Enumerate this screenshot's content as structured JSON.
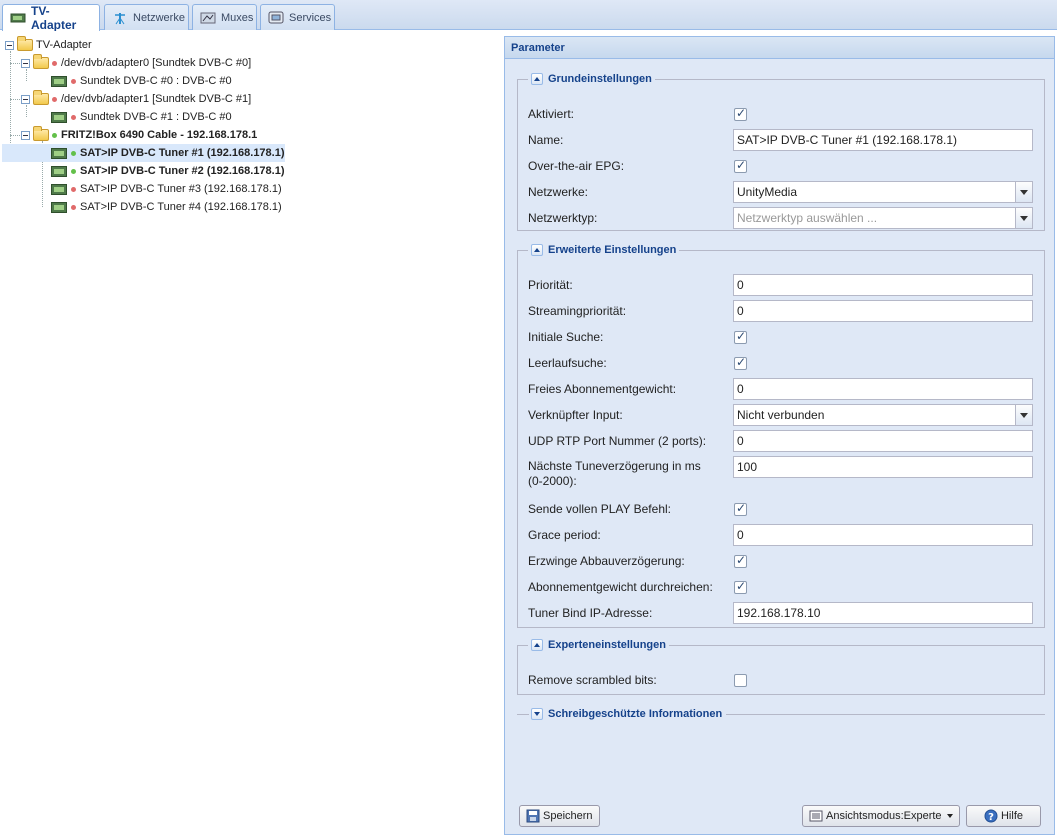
{
  "tabs": [
    {
      "label": "TV-Adapter",
      "icon": "tv-card-icon"
    },
    {
      "label": "Netzwerke",
      "icon": "antenna-icon"
    },
    {
      "label": "Muxes",
      "icon": "mux-icon"
    },
    {
      "label": "Services",
      "icon": "services-icon"
    }
  ],
  "tree": {
    "root": "TV-Adapter",
    "adapter0": "/dev/dvb/adapter0 [Sundtek DVB-C #0]",
    "adapter0_child": "Sundtek DVB-C #0 : DVB-C #0",
    "adapter1": "/dev/dvb/adapter1 [Sundtek DVB-C #1]",
    "adapter1_child": "Sundtek DVB-C #1 : DVB-C #0",
    "fritz": "FRITZ!Box 6490 Cable - 192.168.178.1",
    "tuner1": "SAT>IP DVB-C Tuner #1 (192.168.178.1)",
    "tuner2": "SAT>IP DVB-C Tuner #2 (192.168.178.1)",
    "tuner3": "SAT>IP DVB-C Tuner #3 (192.168.178.1)",
    "tuner4": "SAT>IP DVB-C Tuner #4 (192.168.178.1)"
  },
  "panel": {
    "title": "Parameter",
    "basic": {
      "legend": "Grundeinstellungen",
      "aktiviert": {
        "label": "Aktiviert:",
        "checked": true
      },
      "name": {
        "label": "Name:",
        "value": "SAT>IP DVB-C Tuner #1 (192.168.178.1)"
      },
      "epg": {
        "label": "Over-the-air EPG:",
        "checked": true
      },
      "netzwerke": {
        "label": "Netzwerke:",
        "value": "UnityMedia"
      },
      "netzwerktyp": {
        "label": "Netzwerktyp:",
        "placeholder": "Netzwerktyp auswählen ..."
      }
    },
    "advanced": {
      "legend": "Erweiterte Einstellungen",
      "prioritaet": {
        "label": "Priorität:",
        "value": "0"
      },
      "streaming": {
        "label": "Streamingpriorität:",
        "value": "0"
      },
      "initiale": {
        "label": "Initiale Suche:",
        "checked": true
      },
      "leerlauf": {
        "label": "Leerlaufsuche:",
        "checked": true
      },
      "abo": {
        "label": "Freies Abonnementgewicht:",
        "value": "0"
      },
      "verknuepft": {
        "label": "Verknüpfter Input:",
        "value": "Nicht verbunden"
      },
      "udp": {
        "label": "UDP RTP Port Nummer (2 ports):",
        "value": "0"
      },
      "tunedelay": {
        "label": "Nächste Tuneverzögerung in ms (0-2000):",
        "value": "100"
      },
      "play": {
        "label": "Sende vollen PLAY Befehl:",
        "checked": true
      },
      "grace": {
        "label": "Grace period:",
        "value": "0"
      },
      "abbau": {
        "label": "Erzwinge Abbauverzögerung:",
        "checked": true
      },
      "abodurch": {
        "label": "Abonnementgewicht durchreichen:",
        "checked": true
      },
      "bind": {
        "label": "Tuner Bind IP-Adresse:",
        "value": "192.168.178.10"
      }
    },
    "expert": {
      "legend": "Experteneinstellungen",
      "scrambled": {
        "label": "Remove scrambled bits:",
        "checked": false
      }
    },
    "readonly": {
      "legend": "Schreibgeschützte Informationen"
    }
  },
  "buttons": {
    "save": "Speichern",
    "view": "Ansichtsmodus:Experte",
    "help": "Hilfe"
  }
}
